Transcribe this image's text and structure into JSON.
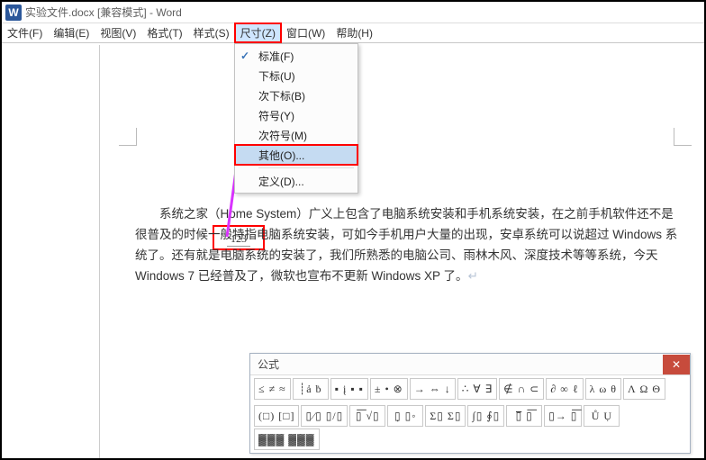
{
  "titlebar": {
    "icon_char": "W",
    "title": "实验文件.docx [兼容模式] - Word"
  },
  "menubar": {
    "items": [
      "文件(F)",
      "编辑(E)",
      "视图(V)",
      "格式(T)",
      "样式(S)",
      "尺寸(Z)",
      "窗口(W)",
      "帮助(H)"
    ],
    "highlighted_index": 5
  },
  "dropdown": {
    "items": [
      {
        "label": "标准(F)",
        "checked": true
      },
      {
        "label": "下标(U)"
      },
      {
        "label": "次下标(B)"
      },
      {
        "label": "符号(Y)"
      },
      {
        "label": "次符号(M)"
      },
      {
        "label": "其他(O)...",
        "selected": true,
        "redbox": true
      },
      {
        "sep": true
      },
      {
        "label": "定义(D)..."
      }
    ]
  },
  "smallbox": {
    "value": "123"
  },
  "document": {
    "paragraph": "系统之家（Home System）广义上包含了电脑系统安装和手机系统安装，在之前手机软件还不是很普及的时候一般特指电脑系统安装，可如今手机用户大量的出现，安卓系统可以说超过 Windows 系统了。还有就是电脑系统的安装了，我们所熟悉的电脑公司、雨林木风、深度技术等等系统，今天 Windows 7 已经普及了，微软也宣布不更新 Windows XP 了。",
    "eol_marker": "↵"
  },
  "equation_panel": {
    "title": "公式",
    "close": "✕",
    "row1": [
      "≤ ≠ ≈",
      "┊ả ḃ",
      "▪ į ▪ ▪",
      "± • ⊗",
      "→ ⇔ ↓",
      "∴ ∀ ∃",
      "∉ ∩ ⊂",
      "∂ ∞ ℓ",
      "λ ω θ",
      "Λ Ω Θ"
    ],
    "row2": [
      "(□) [□]",
      "▯⁄▯ ▯/▯",
      "▯͞ √▯",
      "▯̣ ▯◦",
      "Σ▯ Σ▯",
      "∫▯ ∮▯",
      "▯̅ ▯͞",
      "▯→ ▯͞",
      "Ů Ụ",
      "▓▓▓ ▓▓▓"
    ]
  }
}
